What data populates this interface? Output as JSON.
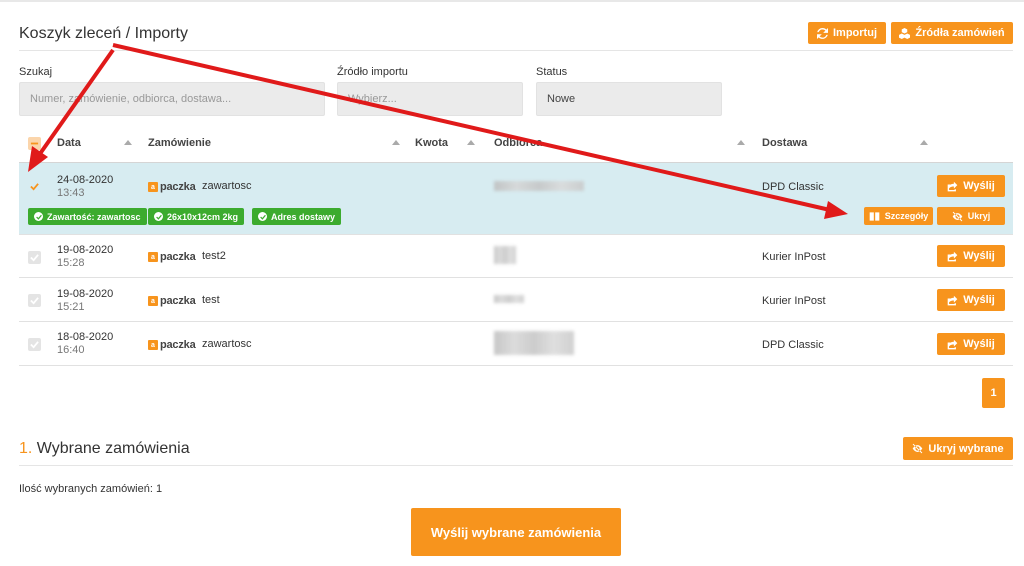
{
  "header": {
    "title": "Koszyk zleceń / Importy",
    "import_label": "Importuj",
    "sources_label": "Źródła zamówień"
  },
  "filters": {
    "search": {
      "label": "Szukaj",
      "placeholder": "Numer, zamówienie, odbiorca, dostawa..."
    },
    "source": {
      "label": "Źródło importu",
      "placeholder": "Wybierz..."
    },
    "status": {
      "label": "Status",
      "value": "Nowe"
    }
  },
  "table": {
    "columns": [
      "Data",
      "Zamówienie",
      "Kwota",
      "Odbiorca",
      "Dostawa"
    ],
    "brand": "paczka",
    "rows": [
      {
        "date": "24-08-2020",
        "time": "13:43",
        "order": "zawartosc",
        "shipping": "DPD Classic",
        "action": "Wyślij",
        "checked": true
      },
      {
        "date": "19-08-2020",
        "time": "15:28",
        "order": "test2",
        "shipping": "Kurier InPost",
        "action": "Wyślij",
        "checked": false
      },
      {
        "date": "19-08-2020",
        "time": "15:21",
        "order": "test",
        "shipping": "Kurier InPost",
        "action": "Wyślij",
        "checked": false
      },
      {
        "date": "18-08-2020",
        "time": "16:40",
        "order": "zawartosc",
        "shipping": "DPD Classic",
        "action": "Wyślij",
        "checked": false
      }
    ],
    "selected_tags": [
      "Zawartość: zawartosc",
      "26x10x12cm 2kg",
      "Adres dostawy"
    ],
    "details_label": "Szczegóły",
    "hide_label": "Ukryj"
  },
  "pagination": {
    "current": "1"
  },
  "selected": {
    "number": "1.",
    "title": "Wybrane zamówienia",
    "hide_selected_label": "Ukryj wybrane",
    "count_text": "Ilość wybranych zamówień: 1",
    "send_selected_label": "Wyślij wybrane zamówienia"
  },
  "colors": {
    "accent": "#f7941d",
    "success": "#3cab2e",
    "highlight": "#d7ecf1",
    "annotation": "#e01a1a"
  }
}
